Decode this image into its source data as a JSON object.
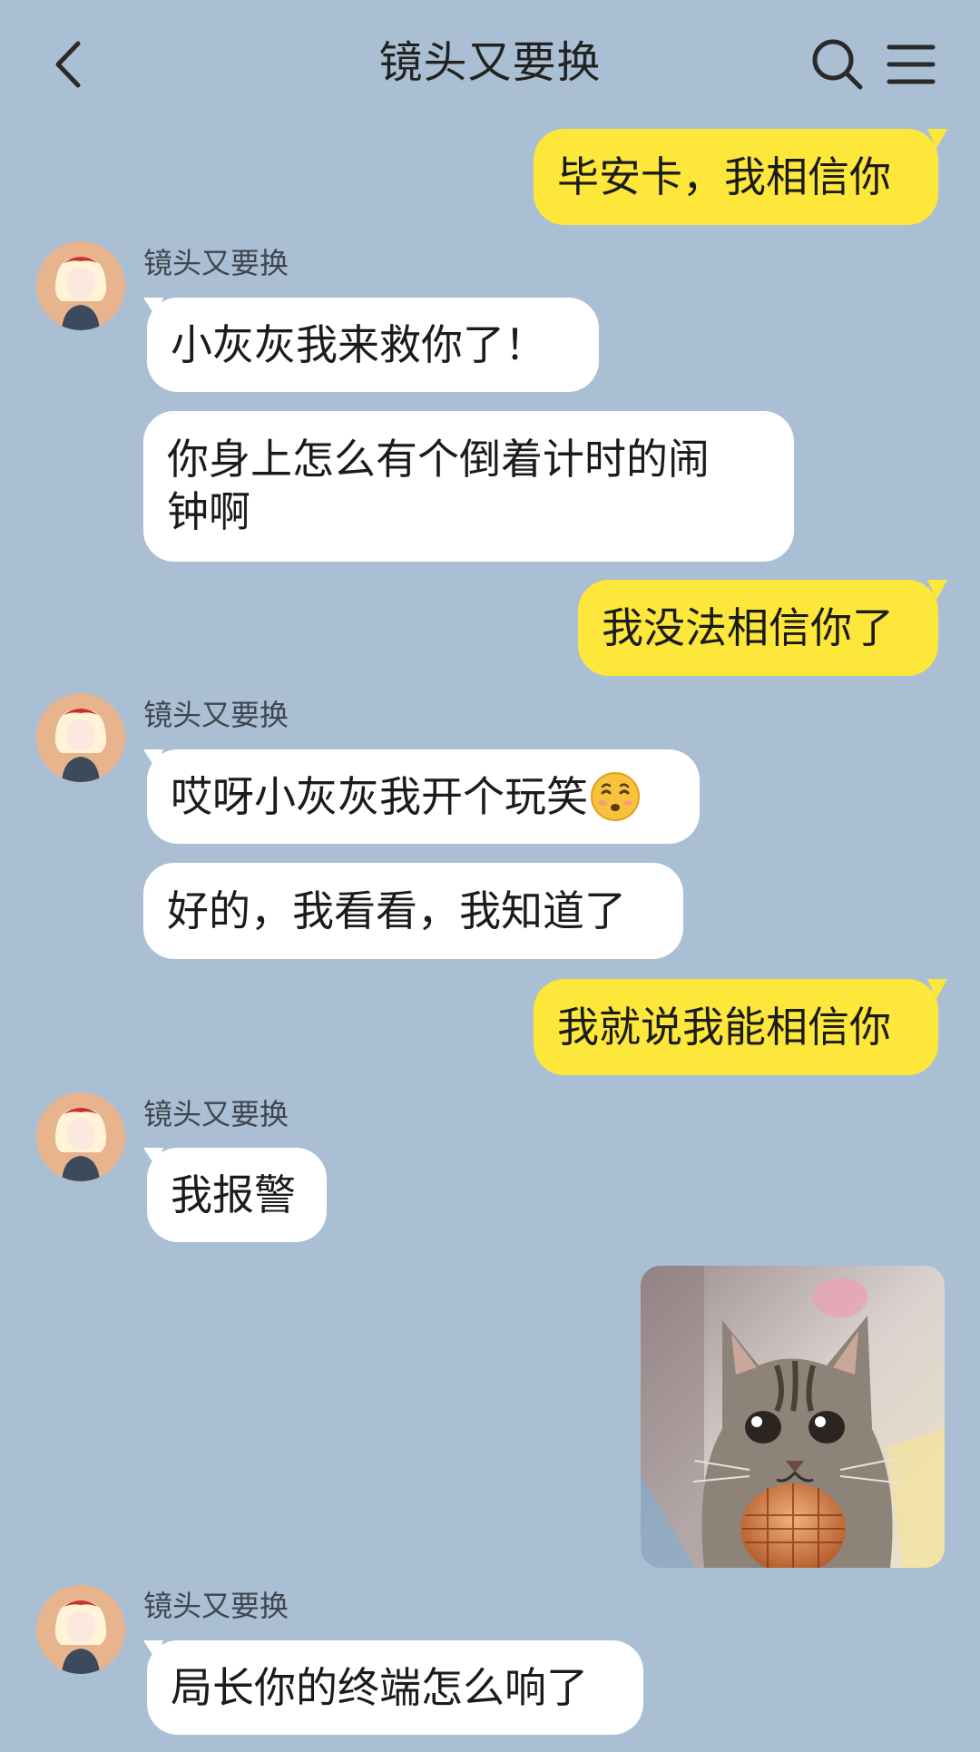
{
  "header": {
    "title": "镜头又要换",
    "back_icon": "chevron-left-icon",
    "search_icon": "search-icon",
    "menu_icon": "menu-icon"
  },
  "colors": {
    "background": "#aabfd3",
    "incoming_bubble": "#ffffff",
    "outgoing_bubble": "#fde73a"
  },
  "messages": [
    {
      "side": "out",
      "text": "毕安卡，我相信你"
    },
    {
      "side": "in",
      "sender": "镜头又要换",
      "text": "小灰灰我来救你了！"
    },
    {
      "side": "in",
      "text": "你身上怎么有个倒着计时的闹钟啊"
    },
    {
      "side": "out",
      "text": "我没法相信你了"
    },
    {
      "side": "in",
      "sender": "镜头又要换",
      "text": "哎呀小灰灰我开个玩笑",
      "emoji": "kissing-face-icon"
    },
    {
      "side": "in",
      "text": "好的，我看看，我知道了"
    },
    {
      "side": "out",
      "text": "我就说我能相信你"
    },
    {
      "side": "in",
      "sender": "镜头又要换",
      "text": "我报警"
    },
    {
      "side": "out",
      "image": "cat-with-microphone-photo"
    },
    {
      "side": "in",
      "sender": "镜头又要换",
      "text": "局长你的终端怎么响了"
    }
  ]
}
